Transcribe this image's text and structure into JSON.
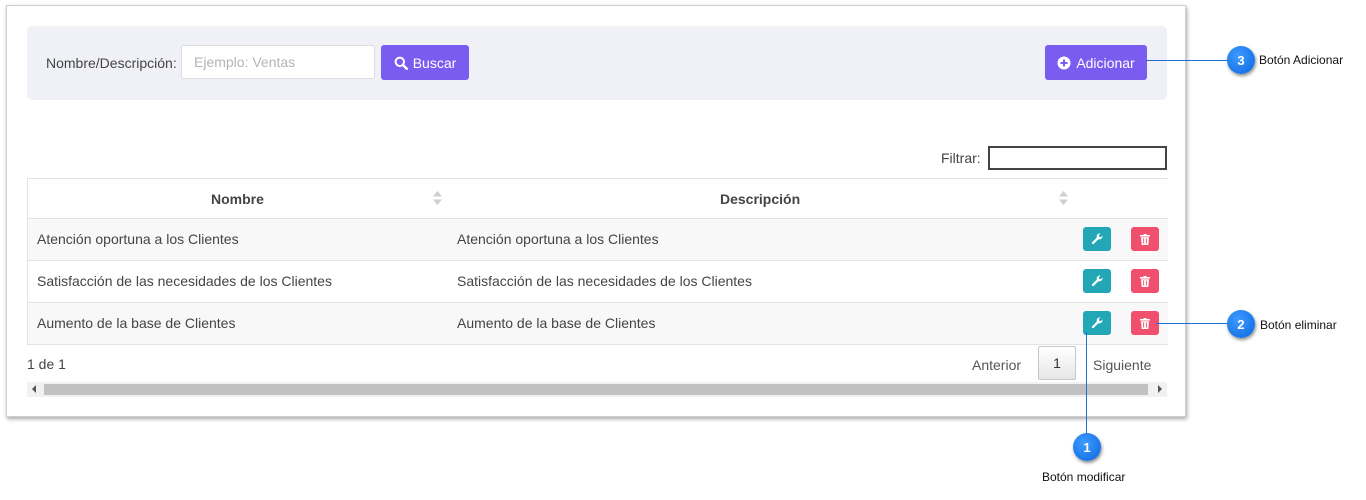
{
  "search": {
    "label": "Nombre/Descripción:",
    "placeholder": "Ejemplo: Ventas",
    "value": "",
    "button_label": "Buscar",
    "button_icon": "search-icon"
  },
  "add": {
    "label": "Adicionar",
    "icon": "plus-circle-icon"
  },
  "filter": {
    "label": "Filtrar:",
    "value": ""
  },
  "table": {
    "headers": [
      "Nombre",
      "Descripción"
    ],
    "rows": [
      {
        "nombre": "Atención oportuna a los Clientes",
        "descripcion": "Atención oportuna a los Clientes"
      },
      {
        "nombre": "Satisfacción de las necesidades de los Clientes",
        "descripcion": "Satisfacción de las necesidades de los Clientes"
      },
      {
        "nombre": "Aumento de la base de Clientes",
        "descripcion": "Aumento de la base de Clientes"
      }
    ],
    "edit_icon": "wrench-icon",
    "delete_icon": "trash-icon"
  },
  "pagination": {
    "info": "1 de 1",
    "previous": "Anterior",
    "current": "1",
    "next": "Siguiente"
  },
  "callouts": [
    {
      "number": "1",
      "label": "Botón modificar"
    },
    {
      "number": "2",
      "label": "Botón eliminar"
    },
    {
      "number": "3",
      "label": "Botón Adicionar"
    }
  ],
  "colors": {
    "primary": "#7b5cf0",
    "edit": "#23a7b6",
    "delete": "#f0506e",
    "callout": "#0b66e0"
  }
}
